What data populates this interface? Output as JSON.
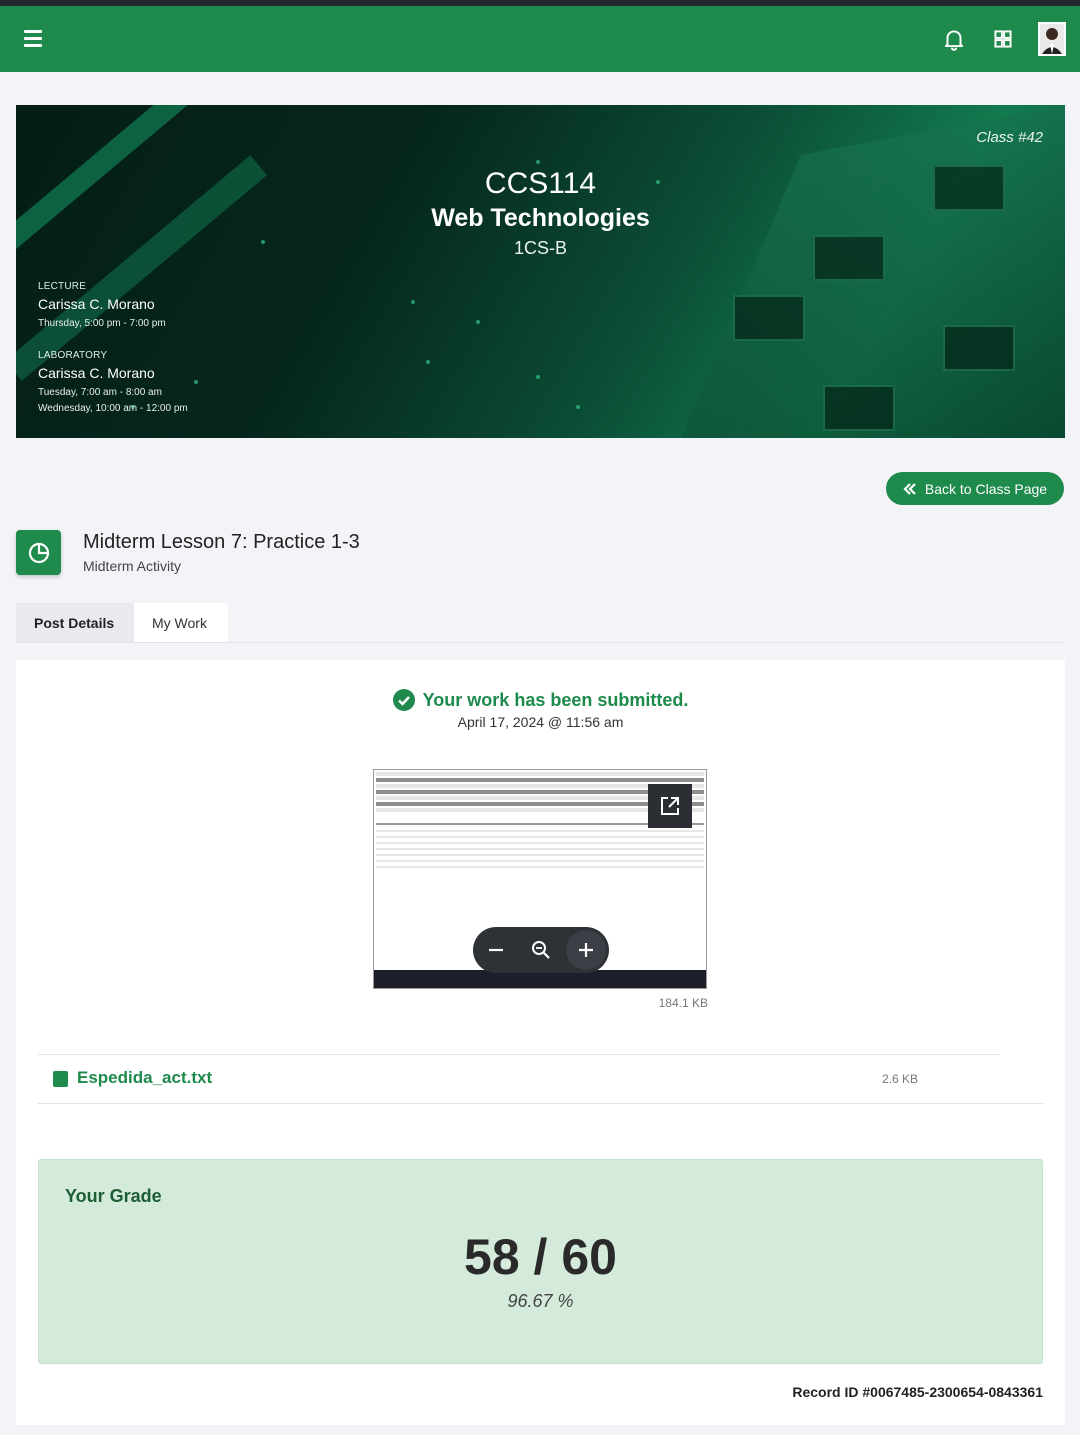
{
  "topbar": {
    "menu_icon": "hamburger-icon",
    "notifications_icon": "bell-icon",
    "apps_icon": "grid-icon",
    "avatar_icon": "user-avatar",
    "brand_color": "#1e8a4c"
  },
  "banner": {
    "class_number": "Class #42",
    "course_code": "CCS114",
    "course_name": "Web Technologies",
    "section": "1CS-B",
    "lecture": {
      "label": "LECTURE",
      "instructor": "Carissa C. Morano",
      "schedule": [
        "Thursday, 5:00 pm - 7:00 pm"
      ]
    },
    "laboratory": {
      "label": "LABORATORY",
      "instructor": "Carissa C. Morano",
      "schedule": [
        "Tuesday, 7:00 am - 8:00 am",
        "Wednesday, 10:00 am - 12:00 pm"
      ]
    }
  },
  "back_button": {
    "label": "Back to Class Page",
    "icon": "double-chevron-left-icon"
  },
  "lesson": {
    "icon": "pie-chart-icon",
    "title": "Midterm Lesson 7: Practice 1-3",
    "subtitle": "Midterm Activity"
  },
  "tabs": [
    {
      "label": "Post Details",
      "active": false
    },
    {
      "label": "My Work",
      "active": true
    }
  ],
  "submission": {
    "status": "Your work has been submitted.",
    "status_icon": "check-circle-icon",
    "date": "April 17, 2024 @ 11:56 am",
    "preview_size": "184.1 KB",
    "preview_controls": {
      "open_icon": "external-link-icon",
      "zoom_out_icon": "minus-icon",
      "reset_icon": "zoom-icon",
      "zoom_in_icon": "plus-icon"
    }
  },
  "attachment": {
    "name": "Espedida_act.txt",
    "size": "2.6 KB",
    "icon": "file-icon"
  },
  "grade": {
    "label": "Your Grade",
    "score": "58 / 60",
    "percent": "96.67 %"
  },
  "record_id": "Record ID #0067485-2300654-0843361"
}
